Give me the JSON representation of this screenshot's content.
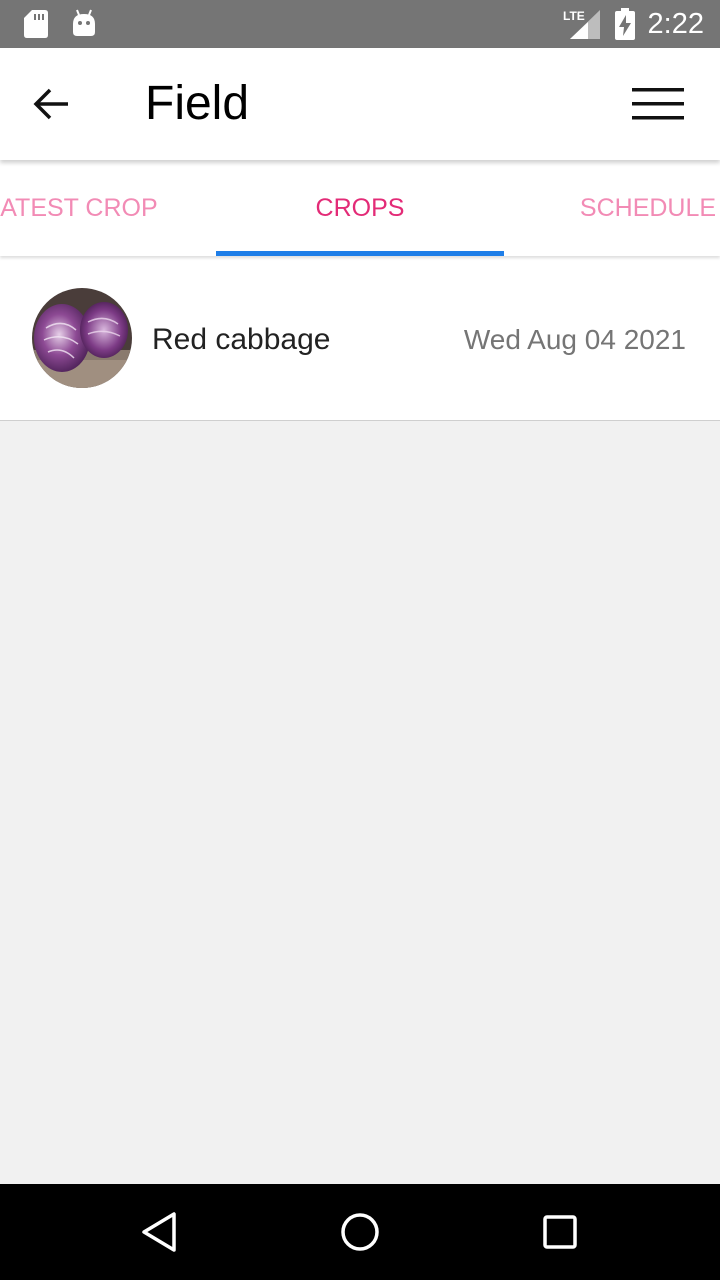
{
  "status_bar": {
    "time": "2:22",
    "network": "LTE",
    "icons": [
      "sd-card-icon",
      "android-icon",
      "lte-signal-icon",
      "battery-charging-icon"
    ]
  },
  "app_bar": {
    "title": "Field",
    "back_icon": "arrow-left-icon",
    "menu_icon": "hamburger-menu-icon"
  },
  "tabs": [
    {
      "label": "LATEST CROP",
      "selected": false
    },
    {
      "label": "CROPS",
      "selected": true
    },
    {
      "label": "SCHEDULE",
      "selected": false
    }
  ],
  "crops": [
    {
      "name": "Red cabbage",
      "date": "Wed Aug 04 2021",
      "image": "red-cabbage-photo"
    }
  ],
  "navigation": {
    "icons": [
      "back-triangle-icon",
      "home-circle-icon",
      "recents-square-icon"
    ]
  },
  "colors": {
    "status_bar": "#757575",
    "tab_active_text": "#e32b77",
    "tab_inactive_text": "#f28bb5",
    "tab_indicator": "#1e7ee8",
    "background": "#f1f1f1"
  }
}
